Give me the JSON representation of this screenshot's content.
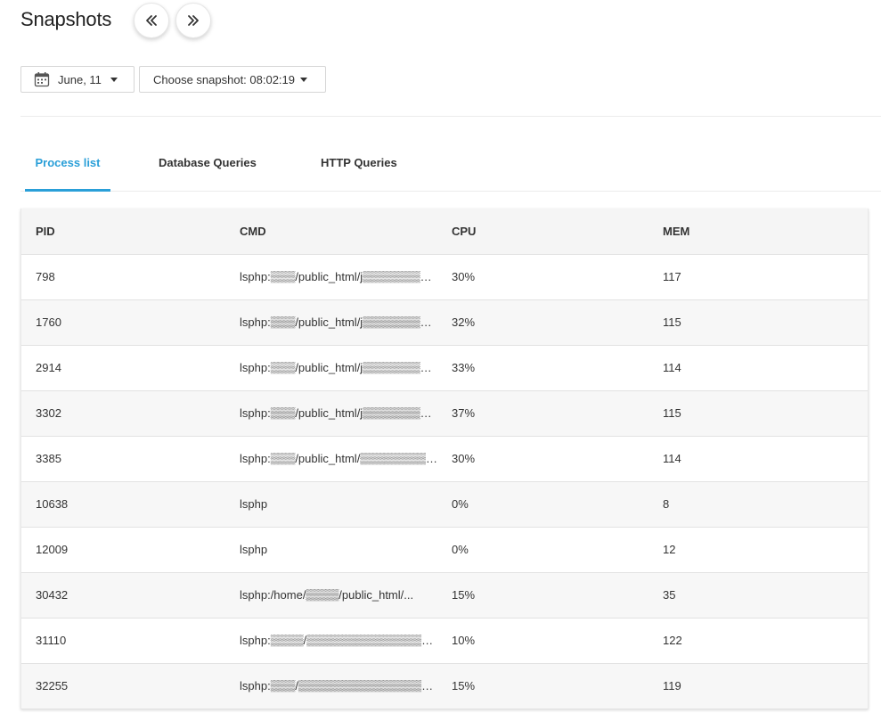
{
  "header": {
    "title": "Snapshots",
    "prev_icon": "double-chevron-left-icon",
    "next_icon": "double-chevron-right-icon"
  },
  "controls": {
    "date_label": "June, 11",
    "date_icon": "calendar-icon",
    "snapshot_label": "Choose snapshot: 08:02:19"
  },
  "tabs": [
    {
      "label": "Process list",
      "active": true
    },
    {
      "label": "Database Queries",
      "active": false
    },
    {
      "label": "HTTP Queries",
      "active": false
    }
  ],
  "table": {
    "columns": [
      "PID",
      "CMD",
      "CPU",
      "MEM"
    ],
    "rows": [
      {
        "pid": "798",
        "cmd": "lsphp:▒▒▒/public_html/j▒▒▒▒▒▒▒▒▒...",
        "cpu": "30%",
        "mem": "117"
      },
      {
        "pid": "1760",
        "cmd": "lsphp:▒▒▒/public_html/j▒▒▒▒▒▒▒▒▒...",
        "cpu": "32%",
        "mem": "115"
      },
      {
        "pid": "2914",
        "cmd": "lsphp:▒▒▒/public_html/j▒▒▒▒▒▒▒▒▒...",
        "cpu": "33%",
        "mem": "114"
      },
      {
        "pid": "3302",
        "cmd": "lsphp:▒▒▒/public_html/j▒▒▒▒▒▒▒▒▒...",
        "cpu": "37%",
        "mem": "115"
      },
      {
        "pid": "3385",
        "cmd": "lsphp:▒▒▒/public_html/▒▒▒▒▒▒▒▒▒▒...",
        "cpu": "30%",
        "mem": "114"
      },
      {
        "pid": "10638",
        "cmd": "lsphp",
        "cpu": "0%",
        "mem": "8"
      },
      {
        "pid": "12009",
        "cmd": "lsphp",
        "cpu": "0%",
        "mem": "12"
      },
      {
        "pid": "30432",
        "cmd": "lsphp:/home/▒▒▒▒/public_html/...",
        "cpu": "15%",
        "mem": "35"
      },
      {
        "pid": "31110",
        "cmd": "lsphp:▒▒▒▒/▒▒▒▒▒▒▒▒▒▒▒▒▒▒▒▒▒▒...",
        "cpu": "10%",
        "mem": "122"
      },
      {
        "pid": "32255",
        "cmd": "lsphp:▒▒▒/▒▒▒▒▒▒▒▒▒▒▒▒▒▒▒▒▒▒▒...",
        "cpu": "15%",
        "mem": "119"
      }
    ]
  },
  "colors": {
    "accent": "#2a9fd8",
    "text": "#333333",
    "row_alt": "#f7f7f7",
    "header_bg": "#f5f5f5"
  }
}
